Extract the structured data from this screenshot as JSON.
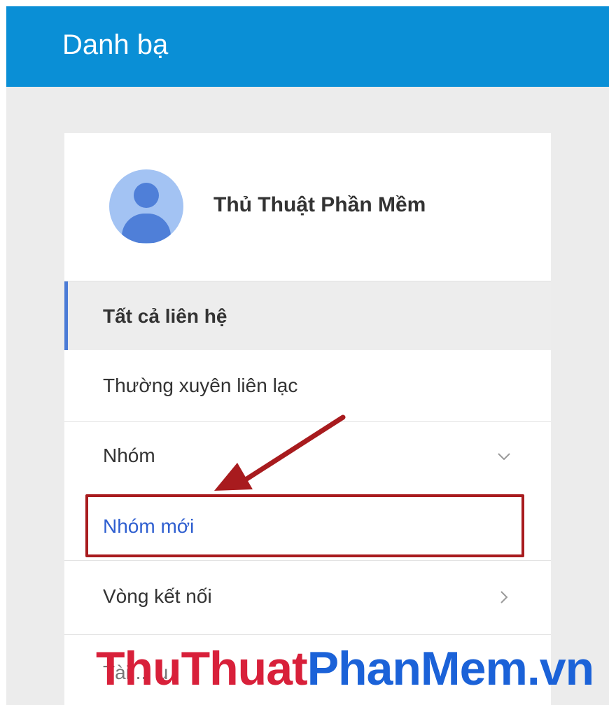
{
  "header": {
    "title": "Danh bạ"
  },
  "profile": {
    "name": "Thủ Thuật Phần Mềm",
    "avatar_icon": "person-avatar-icon"
  },
  "nav": {
    "all_contacts": "Tất cả liên hệ",
    "frequent": "Thường xuyên liên lạc",
    "groups": "Nhóm",
    "new_group": "Nhóm mới",
    "circles": "Vòng kết nối",
    "partially_hidden": "Tài ... u"
  },
  "watermark": {
    "part1": "ThuThuat",
    "part2": "PhanMem.vn"
  },
  "colors": {
    "header_bg": "#0a8fd6",
    "active_indicator": "#4b7bd6",
    "link": "#2f5fd0",
    "annotation_red": "#a81b1e",
    "watermark_red": "#d8203a",
    "watermark_blue": "#1b62d8"
  }
}
